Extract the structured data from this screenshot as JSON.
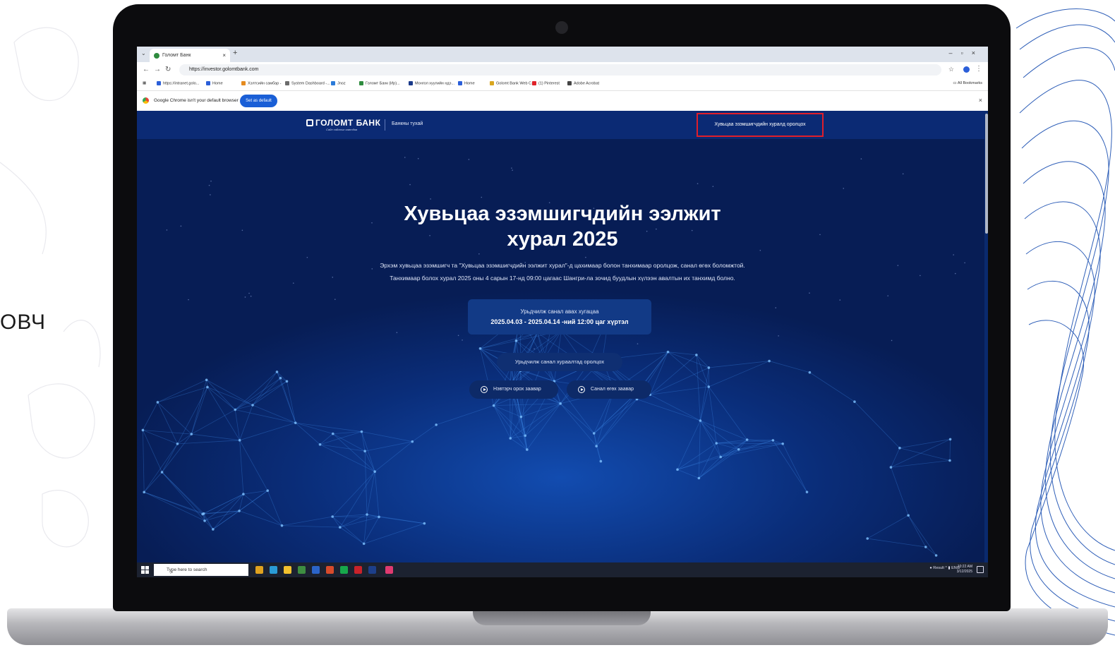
{
  "side_text": "ОВЧ",
  "browser": {
    "tab_title": "Голомт Банк",
    "new_tab": "+",
    "tab_close": "×",
    "url": "https://investor.golomtbank.com",
    "bookmarks": [
      {
        "label": "https://intranet.golo...",
        "color": "#2b5fd9"
      },
      {
        "label": "Home",
        "color": "#2b5fd9"
      },
      {
        "label": "Хэлтсийн самбар -",
        "color": "#e58b1f"
      },
      {
        "label": "System Dashboard -...",
        "color": "#6b6b6b"
      },
      {
        "label": "Jnoz",
        "color": "#2b7bd9"
      },
      {
        "label": "Голомт Банк (Ир)...",
        "color": "#2e8b3e"
      },
      {
        "label": "Монгол хуулийн ндэ...",
        "color": "#1a3a8a"
      },
      {
        "label": "Home",
        "color": "#2b5fd9"
      },
      {
        "label": "Golomt Bank Web C...",
        "color": "#d9a61f"
      },
      {
        "label": "(1) Pinterest",
        "color": "#e0232a"
      },
      {
        "label": "Adobe Acrobat",
        "color": "#444444"
      }
    ],
    "all_bookmarks": "All Bookmarks",
    "infobar_message": "Google Chrome isn't your default browser",
    "set_default_label": "Set as default"
  },
  "site": {
    "logo_text": "ГОЛОМТ БАНК",
    "logo_tagline": "Сайн сайхныг хамтдаа",
    "nav_about": "Банкны тухай",
    "join_meeting": "Хувьцаа эзэмшигчдийн хуралд оролцох",
    "title_line1": "Хувьцаа эзэмшигчдийн ээлжит",
    "title_line2": "хурал 2025",
    "desc_line1": "Эрхэм хувьцаа эзэмшигч та \"Хувьцаа эзэмшигчдийн ээлжит хурал\"-д цахимаар болон танхимаар оролцож, санал өгөх боломжтой.",
    "desc_line2": "Танхимаар болох хурал 2025 оны 4 сарын 17-нд 09:00 цагаас Шангри-ла зочид буудлын хүлээн авалтын их танхимд болно.",
    "advance_vote_label": "Урьдчилж санал авах хугацаа",
    "advance_vote_dates": "2025.04.03 - 2025.04.14 -ний 12:00 цаг хүртэл",
    "advance_vote_button": "Урьдчилж санал хураалтад оролцох",
    "guide_login": "Нэвтэрч орох заавар",
    "guide_vote": "Санал өгөх заавар"
  },
  "taskbar": {
    "search_placeholder": "Type here to search",
    "tray_text": "Result",
    "lang": "ENG",
    "time": "10:22 AM",
    "date": "3/12/2025"
  },
  "colors": {
    "page_bg": "#071d55",
    "highlight_border": "#e01e2a",
    "primary_button": "#1a5fd6"
  }
}
